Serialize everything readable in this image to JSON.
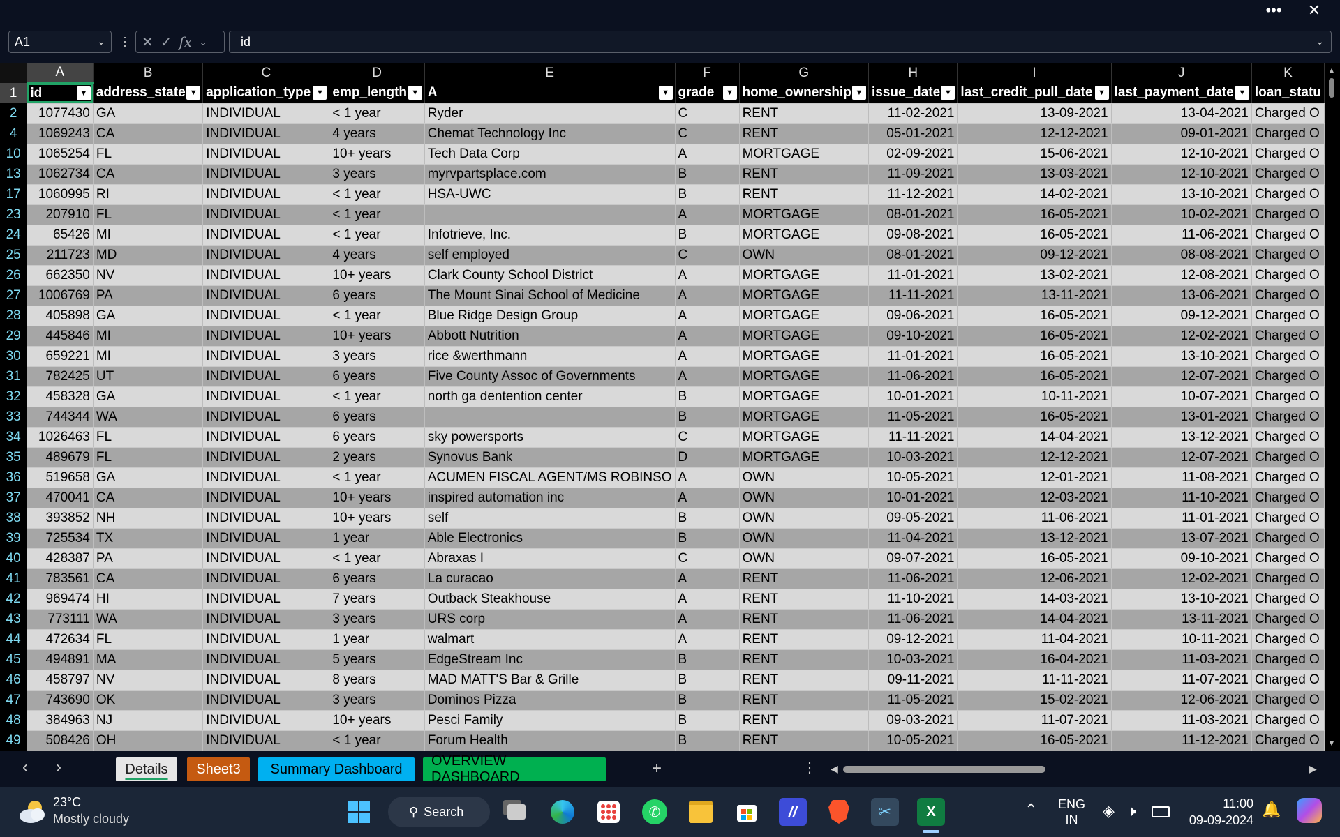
{
  "window": {
    "more_label": "•••",
    "close_label": "✕"
  },
  "formula_bar": {
    "name_box": "A1",
    "formula_value": "id",
    "cancel_glyph": "✕",
    "enter_glyph": "✓",
    "fx_glyph": "fx"
  },
  "columns": [
    "A",
    "B",
    "C",
    "D",
    "E",
    "F",
    "G",
    "H",
    "I",
    "J",
    "K"
  ],
  "headers": [
    "id",
    "address_state",
    "application_type",
    "emp_length",
    "A",
    "grade",
    "home_ownership",
    "issue_date",
    "last_credit_pull_date",
    "last_payment_date",
    "loan_statu"
  ],
  "rows": [
    {
      "row": "2",
      "v": [
        "1077430",
        "GA",
        "INDIVIDUAL",
        "< 1 year",
        "Ryder",
        "C",
        "RENT",
        "11-02-2021",
        "13-09-2021",
        "13-04-2021",
        "Charged O"
      ]
    },
    {
      "row": "4",
      "v": [
        "1069243",
        "CA",
        "INDIVIDUAL",
        "4 years",
        "Chemat Technology Inc",
        "C",
        "RENT",
        "05-01-2021",
        "12-12-2021",
        "09-01-2021",
        "Charged O"
      ]
    },
    {
      "row": "10",
      "v": [
        "1065254",
        "FL",
        "INDIVIDUAL",
        "10+ years",
        "Tech Data Corp",
        "A",
        "MORTGAGE",
        "02-09-2021",
        "15-06-2021",
        "12-10-2021",
        "Charged O"
      ]
    },
    {
      "row": "13",
      "v": [
        "1062734",
        "CA",
        "INDIVIDUAL",
        "3 years",
        "myrvpartsplace.com",
        "B",
        "RENT",
        "11-09-2021",
        "13-03-2021",
        "12-10-2021",
        "Charged O"
      ]
    },
    {
      "row": "17",
      "v": [
        "1060995",
        "RI",
        "INDIVIDUAL",
        "< 1 year",
        "HSA-UWC",
        "B",
        "RENT",
        "11-12-2021",
        "14-02-2021",
        "13-10-2021",
        "Charged O"
      ]
    },
    {
      "row": "23",
      "v": [
        "207910",
        "FL",
        "INDIVIDUAL",
        "< 1 year",
        "",
        "A",
        "MORTGAGE",
        "08-01-2021",
        "16-05-2021",
        "10-02-2021",
        "Charged O"
      ]
    },
    {
      "row": "24",
      "v": [
        "65426",
        "MI",
        "INDIVIDUAL",
        "< 1 year",
        "Infotrieve, Inc.",
        "B",
        "MORTGAGE",
        "09-08-2021",
        "16-05-2021",
        "11-06-2021",
        "Charged O"
      ]
    },
    {
      "row": "25",
      "v": [
        "211723",
        "MD",
        "INDIVIDUAL",
        "4 years",
        "self employed",
        "C",
        "OWN",
        "08-01-2021",
        "09-12-2021",
        "08-08-2021",
        "Charged O"
      ]
    },
    {
      "row": "26",
      "v": [
        "662350",
        "NV",
        "INDIVIDUAL",
        "10+ years",
        "Clark County School District",
        "A",
        "MORTGAGE",
        "11-01-2021",
        "13-02-2021",
        "12-08-2021",
        "Charged O"
      ]
    },
    {
      "row": "27",
      "v": [
        "1006769",
        "PA",
        "INDIVIDUAL",
        "6 years",
        "The Mount Sinai School of Medicine",
        "A",
        "MORTGAGE",
        "11-11-2021",
        "13-11-2021",
        "13-06-2021",
        "Charged O"
      ]
    },
    {
      "row": "28",
      "v": [
        "405898",
        "GA",
        "INDIVIDUAL",
        "< 1 year",
        "Blue Ridge Design Group",
        "A",
        "MORTGAGE",
        "09-06-2021",
        "16-05-2021",
        "09-12-2021",
        "Charged O"
      ]
    },
    {
      "row": "29",
      "v": [
        "445846",
        "MI",
        "INDIVIDUAL",
        "10+ years",
        "Abbott Nutrition",
        "A",
        "MORTGAGE",
        "09-10-2021",
        "16-05-2021",
        "12-02-2021",
        "Charged O"
      ]
    },
    {
      "row": "30",
      "v": [
        "659221",
        "MI",
        "INDIVIDUAL",
        "3 years",
        "rice &werthmann",
        "A",
        "MORTGAGE",
        "11-01-2021",
        "16-05-2021",
        "13-10-2021",
        "Charged O"
      ]
    },
    {
      "row": "31",
      "v": [
        "782425",
        "UT",
        "INDIVIDUAL",
        "6 years",
        "Five County Assoc of Governments",
        "A",
        "MORTGAGE",
        "11-06-2021",
        "16-05-2021",
        "12-07-2021",
        "Charged O"
      ]
    },
    {
      "row": "32",
      "v": [
        "458328",
        "GA",
        "INDIVIDUAL",
        "< 1 year",
        "north ga dentention center",
        "B",
        "MORTGAGE",
        "10-01-2021",
        "10-11-2021",
        "10-07-2021",
        "Charged O"
      ]
    },
    {
      "row": "33",
      "v": [
        "744344",
        "WA",
        "INDIVIDUAL",
        "6 years",
        "",
        "B",
        "MORTGAGE",
        "11-05-2021",
        "16-05-2021",
        "13-01-2021",
        "Charged O"
      ]
    },
    {
      "row": "34",
      "v": [
        "1026463",
        "FL",
        "INDIVIDUAL",
        "6 years",
        "sky powersports",
        "C",
        "MORTGAGE",
        "11-11-2021",
        "14-04-2021",
        "13-12-2021",
        "Charged O"
      ]
    },
    {
      "row": "35",
      "v": [
        "489679",
        "FL",
        "INDIVIDUAL",
        "2 years",
        "Synovus Bank",
        "D",
        "MORTGAGE",
        "10-03-2021",
        "12-12-2021",
        "12-07-2021",
        "Charged O"
      ]
    },
    {
      "row": "36",
      "v": [
        "519658",
        "GA",
        "INDIVIDUAL",
        "< 1 year",
        "ACUMEN FISCAL AGENT/MS ROBINSO",
        "A",
        "OWN",
        "10-05-2021",
        "12-01-2021",
        "11-08-2021",
        "Charged O"
      ]
    },
    {
      "row": "37",
      "v": [
        "470041",
        "CA",
        "INDIVIDUAL",
        "10+ years",
        "inspired automation inc",
        "A",
        "OWN",
        "10-01-2021",
        "12-03-2021",
        "11-10-2021",
        "Charged O"
      ]
    },
    {
      "row": "38",
      "v": [
        "393852",
        "NH",
        "INDIVIDUAL",
        "10+ years",
        "self",
        "B",
        "OWN",
        "09-05-2021",
        "11-06-2021",
        "11-01-2021",
        "Charged O"
      ]
    },
    {
      "row": "39",
      "v": [
        "725534",
        "TX",
        "INDIVIDUAL",
        "1 year",
        "Able Electronics",
        "B",
        "OWN",
        "11-04-2021",
        "13-12-2021",
        "13-07-2021",
        "Charged O"
      ]
    },
    {
      "row": "40",
      "v": [
        "428387",
        "PA",
        "INDIVIDUAL",
        "< 1 year",
        "Abraxas I",
        "C",
        "OWN",
        "09-07-2021",
        "16-05-2021",
        "09-10-2021",
        "Charged O"
      ]
    },
    {
      "row": "41",
      "v": [
        "783561",
        "CA",
        "INDIVIDUAL",
        "6 years",
        "La curacao",
        "A",
        "RENT",
        "11-06-2021",
        "12-06-2021",
        "12-02-2021",
        "Charged O"
      ]
    },
    {
      "row": "42",
      "v": [
        "969474",
        "HI",
        "INDIVIDUAL",
        "7 years",
        "Outback Steakhouse",
        "A",
        "RENT",
        "11-10-2021",
        "14-03-2021",
        "13-10-2021",
        "Charged O"
      ]
    },
    {
      "row": "43",
      "v": [
        "773111",
        "WA",
        "INDIVIDUAL",
        "3 years",
        "URS corp",
        "A",
        "RENT",
        "11-06-2021",
        "14-04-2021",
        "13-11-2021",
        "Charged O"
      ]
    },
    {
      "row": "44",
      "v": [
        "472634",
        "FL",
        "INDIVIDUAL",
        "1 year",
        "walmart",
        "A",
        "RENT",
        "09-12-2021",
        "11-04-2021",
        "10-11-2021",
        "Charged O"
      ]
    },
    {
      "row": "45",
      "v": [
        "494891",
        "MA",
        "INDIVIDUAL",
        "5 years",
        "EdgeStream Inc",
        "B",
        "RENT",
        "10-03-2021",
        "16-04-2021",
        "11-03-2021",
        "Charged O"
      ]
    },
    {
      "row": "46",
      "v": [
        "458797",
        "NV",
        "INDIVIDUAL",
        "8 years",
        "MAD MATT'S Bar & Grille",
        "B",
        "RENT",
        "09-11-2021",
        "11-11-2021",
        "11-07-2021",
        "Charged O"
      ]
    },
    {
      "row": "47",
      "v": [
        "743690",
        "OK",
        "INDIVIDUAL",
        "3 years",
        "Dominos Pizza",
        "B",
        "RENT",
        "11-05-2021",
        "15-02-2021",
        "12-06-2021",
        "Charged O"
      ]
    },
    {
      "row": "48",
      "v": [
        "384963",
        "NJ",
        "INDIVIDUAL",
        "10+ years",
        "Pesci Family",
        "B",
        "RENT",
        "09-03-2021",
        "11-07-2021",
        "11-03-2021",
        "Charged O"
      ]
    },
    {
      "row": "49",
      "v": [
        "508426",
        "OH",
        "INDIVIDUAL",
        "< 1 year",
        "Forum Health",
        "B",
        "RENT",
        "10-05-2021",
        "16-05-2021",
        "11-12-2021",
        "Charged O"
      ]
    }
  ],
  "sheet_tabs": [
    {
      "label": "Details",
      "bg": "#e6e6e6",
      "fg": "#222222",
      "active": true
    },
    {
      "label": "Sheet3",
      "bg": "#c55a11",
      "fg": "#ffffff",
      "active": false
    },
    {
      "label": "Summary Dashboard",
      "bg": "#00b0f0",
      "fg": "#000000",
      "active": false
    },
    {
      "label": "OVERVIEW DASHBOARD",
      "bg": "#00b050",
      "fg": "#000000",
      "active": false
    }
  ],
  "tab_nav": {
    "prev": "‹",
    "next": "›",
    "add": "+",
    "more": "⋮"
  },
  "taskbar": {
    "weather_temp": "23°C",
    "weather_desc": "Mostly cloudy",
    "search_label": "Search",
    "lang_top": "ENG",
    "lang_bottom": "IN",
    "time": "11:00",
    "date": "09-09-2024"
  },
  "colors": {
    "selection": "#21a366",
    "row_light": "#d9d9d9",
    "row_dark": "#a6a6a6",
    "row_number": "#7fd9f0"
  }
}
